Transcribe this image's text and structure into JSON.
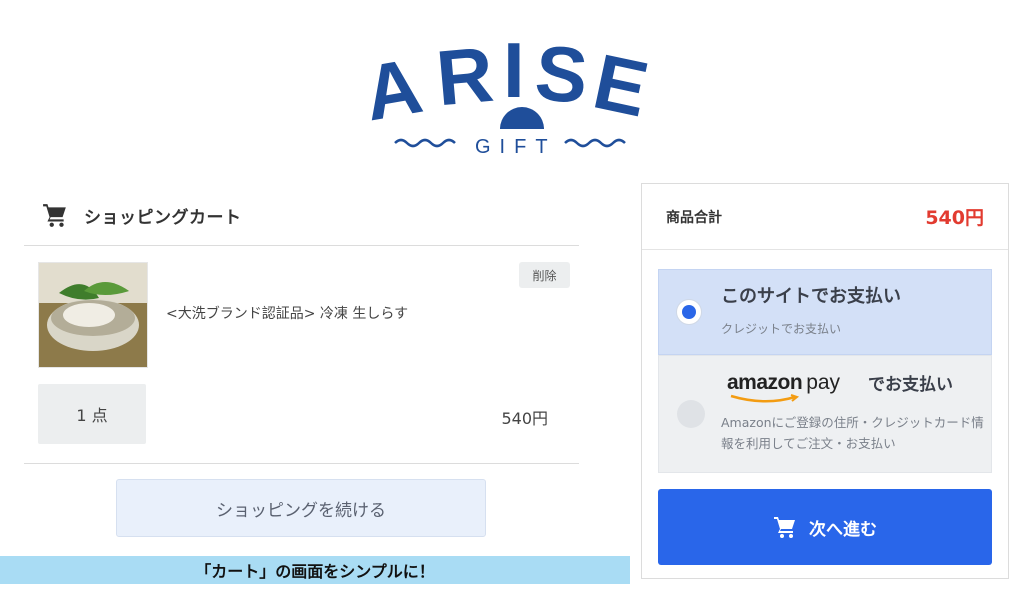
{
  "brand": {
    "logo_text": "ARISE",
    "logo_sub": "GIFT"
  },
  "cart": {
    "title": "ショッピングカート",
    "item": {
      "name": "<大洗ブランド認証品> 冷凍 生しらす",
      "delete_label": "削除",
      "quantity": "1 点",
      "price": "540円"
    },
    "continue_label": "ショッピングを続ける"
  },
  "caption": "「カート」の画面をシンプルに！",
  "summary": {
    "total_label": "商品合計",
    "total_value": "540円",
    "options": [
      {
        "title": "このサイトでお支払い",
        "subtitle": "クレジットでお支払い",
        "selected": true
      },
      {
        "logo_amazon": "amazon",
        "logo_pay": "pay",
        "title_suffix": "でお支払い",
        "description": "Amazonにご登録の住所・クレジットカード情報を利用してご注文・お支払い",
        "selected": false
      }
    ],
    "next_label": "次へ進む"
  },
  "colors": {
    "brand_blue": "#1f4e9a",
    "accent_red": "#e23b30",
    "primary_button": "#2966ea",
    "selected_option": "#d3e0f7"
  },
  "icons": [
    "cart-icon",
    "radio-selected-icon",
    "radio-unselected-icon",
    "amazon-smile-icon"
  ]
}
